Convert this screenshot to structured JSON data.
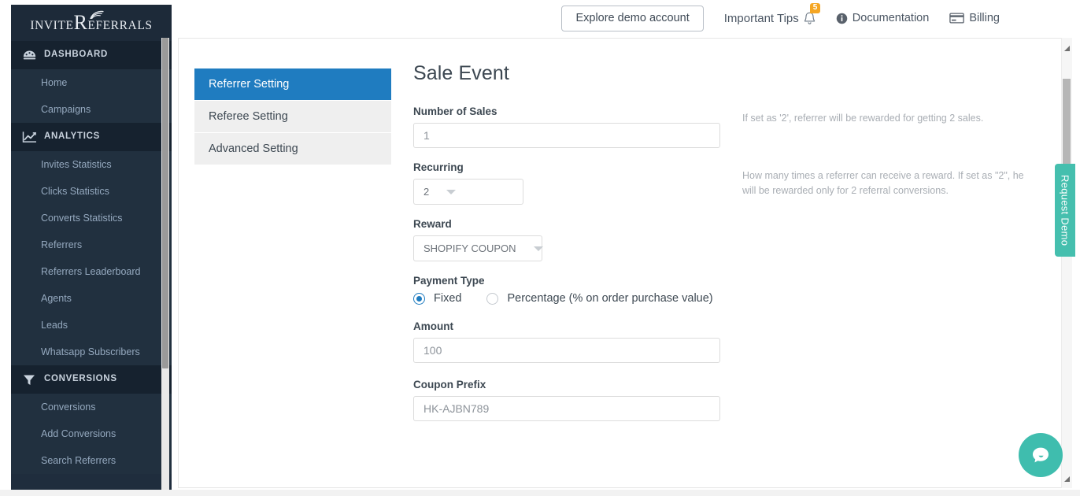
{
  "brand": {
    "logo_part1": "INVITE",
    "logo_r": "R",
    "logo_part2": "EFERRALS",
    "wifi_icon": "wifi-signal-icon"
  },
  "topbar": {
    "explore_button": "Explore demo account",
    "tips_label": "Important Tips",
    "tips_badge": "5",
    "bell_icon": "bell-icon",
    "documentation_label": "Documentation",
    "documentation_icon": "info-circle-icon",
    "billing_label": "Billing",
    "billing_icon": "credit-card-icon"
  },
  "sidebar": {
    "sections": [
      {
        "label": "DASHBOARD",
        "icon": "speedometer-icon",
        "items": [
          {
            "label": "Home"
          },
          {
            "label": "Campaigns"
          }
        ]
      },
      {
        "label": "ANALYTICS",
        "icon": "line-chart-icon",
        "items": [
          {
            "label": "Invites Statistics"
          },
          {
            "label": "Clicks Statistics"
          },
          {
            "label": "Converts Statistics"
          },
          {
            "label": "Referrers"
          },
          {
            "label": "Referrers Leaderboard"
          },
          {
            "label": "Agents"
          },
          {
            "label": "Leads"
          },
          {
            "label": "Whatsapp Subscribers"
          }
        ]
      },
      {
        "label": "CONVERSIONS",
        "icon": "funnel-icon",
        "items": [
          {
            "label": "Conversions"
          },
          {
            "label": "Add Conversions"
          },
          {
            "label": "Search Referrers"
          }
        ]
      }
    ]
  },
  "tabs": [
    {
      "label": "Referrer Setting",
      "active": true
    },
    {
      "label": "Referee Setting",
      "active": false
    },
    {
      "label": "Advanced Setting",
      "active": false
    }
  ],
  "form": {
    "title": "Sale Event",
    "number_of_sales": {
      "label": "Number of Sales",
      "value": "1",
      "help": "If set as '2', referrer will be rewarded for getting 2 sales."
    },
    "recurring": {
      "label": "Recurring",
      "value": "2",
      "help": "How many times a referrer can receive a reward. If set as \"2\", he will be rewarded only for 2 referral conversions."
    },
    "reward": {
      "label": "Reward",
      "value": "SHOPIFY COUPON"
    },
    "payment_type": {
      "label": "Payment Type",
      "options": [
        {
          "label": "Fixed",
          "selected": true
        },
        {
          "label": "Percentage (% on order purchase value)",
          "selected": false
        }
      ]
    },
    "amount": {
      "label": "Amount",
      "value": "100"
    },
    "coupon_prefix": {
      "label": "Coupon Prefix",
      "value": "HK-AJBN789"
    }
  },
  "widgets": {
    "request_demo": "Request Demo",
    "chat_icon": "chat-bubble-icon"
  },
  "colors": {
    "sidebar_bg": "#1f2d3d",
    "sidebar_section_bg": "#16222f",
    "accent_blue": "#1f7cc0",
    "badge_orange": "#f5a623",
    "teal": "#45bfae"
  }
}
